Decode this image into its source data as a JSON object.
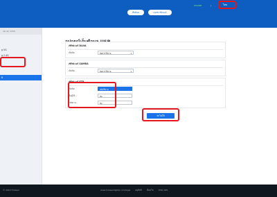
{
  "topbar": {
    "status": "ONLINE",
    "separator": "|",
    "language": "ไทย",
    "nav_buttons": [
      "สืบค้นห",
      "แอสชาร์มิเมอร์"
    ]
  },
  "sidebar": {
    "header": "4G AC 1200",
    "items": [
      "g 5G",
      "g 2.4G",
      "",
      "B"
    ]
  },
  "page": {
    "title": "อุปกรณ์เก็บข้อมูล USB",
    "subtitle": "หน้านี้ใช้สำหรับตั้งค่า DLNA Server, SAMBA Server, FTP Server"
  },
  "sections": {
    "dlna": {
      "title": "เซิร์ฟเวอร์ DLNA",
      "label": "เปิดปิด",
      "value": "ปิดการใช้งาน"
    },
    "samba": {
      "title": "เซิร์ฟเวอร์ SAMBA",
      "label": "เปิดปิด",
      "value": "ปิดการใช้งาน"
    },
    "ftp": {
      "title": "เซิร์ฟเวอร์ FTP",
      "fields": [
        {
          "label": "เปิดปิด",
          "value": "เปิดใช้งาน"
        },
        {
          "label": "ชื่อผู้ใช้",
          "value": "ftp"
        },
        {
          "label": "รหัสผ่าน",
          "value": "ftp"
        }
      ]
    }
  },
  "apply_label": "นำไปใช้",
  "footer": {
    "copyright": "© 2019 Huawei",
    "links": [
      "www.huaweidigital.com/wgw",
      "อนุสิทธิ",
      "เงื่อนไข",
      "OSS/ GPL"
    ]
  }
}
